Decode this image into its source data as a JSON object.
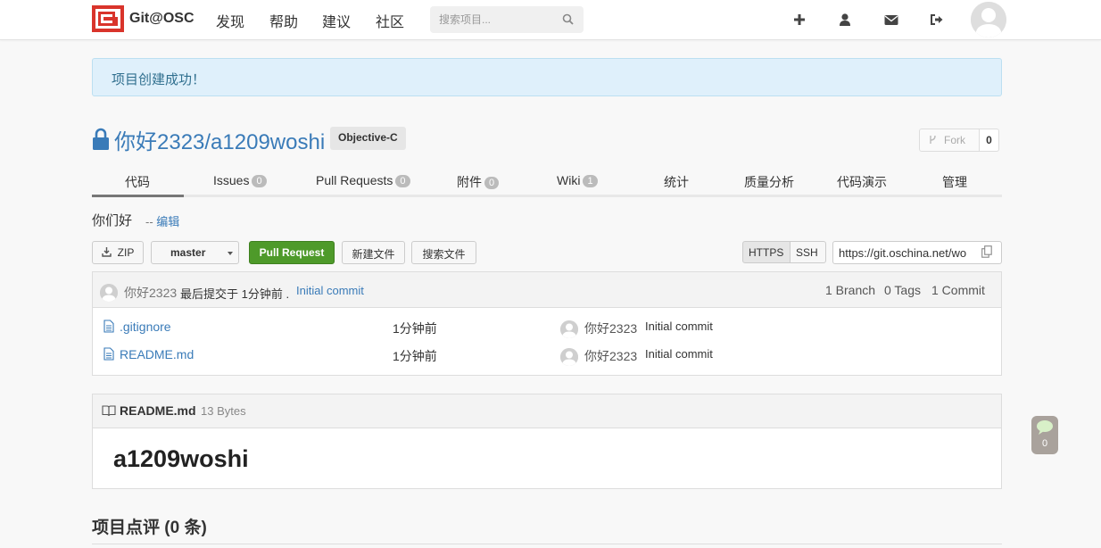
{
  "header": {
    "logo_text": "Git@OSC",
    "nav": [
      "发现",
      "帮助",
      "建议",
      "社区"
    ],
    "search_placeholder": "搜索项目..."
  },
  "alert": "项目创建成功！",
  "project": {
    "title": "你好2323/a1209woshi",
    "language": "Objective-C",
    "fork_label": "Fork",
    "fork_count": "0"
  },
  "tabs": [
    {
      "label": "代码"
    },
    {
      "label": "Issues",
      "count": "0"
    },
    {
      "label": "Pull Requests",
      "count": "0"
    },
    {
      "label": "附件",
      "count": "0"
    },
    {
      "label": "Wiki",
      "count": "1"
    },
    {
      "label": "统计"
    },
    {
      "label": "质量分析"
    },
    {
      "label": "代码演示"
    },
    {
      "label": "管理"
    }
  ],
  "description": {
    "text": "你们好",
    "edit_prefix": "--",
    "edit_label": "编辑"
  },
  "toolbar": {
    "zip": "ZIP",
    "branch": "master",
    "pull_request": "Pull Request",
    "new_file": "新建文件",
    "search_file": "搜索文件",
    "https": "HTTPS",
    "ssh": "SSH",
    "clone_url": "https://git.oschina.net/wo"
  },
  "last_commit": {
    "author": "你好2323",
    "text": "最后提交于 1分钟前 .",
    "message": "Initial commit",
    "branches": "1 Branch",
    "tags": "0 Tags",
    "commits": "1 Commit"
  },
  "files": [
    {
      "name": ".gitignore",
      "time": "1分钟前",
      "author": "你好2323",
      "message": "Initial commit"
    },
    {
      "name": "README.md",
      "time": "1分钟前",
      "author": "你好2323",
      "message": "Initial commit"
    }
  ],
  "readme": {
    "filename": "README.md",
    "size": "13 Bytes",
    "heading": "a1209woshi"
  },
  "comments_title": "项目点评 (0 条)",
  "chat_count": "0"
}
